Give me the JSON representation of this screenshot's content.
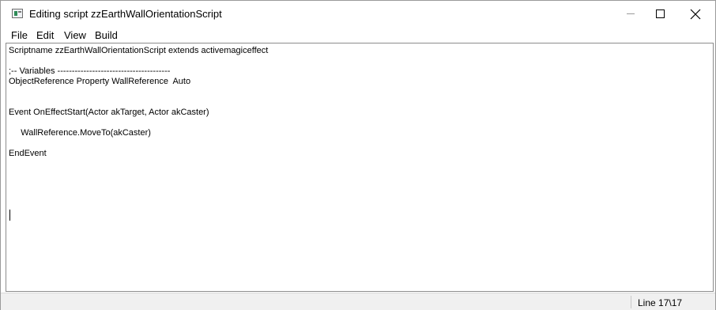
{
  "window": {
    "title": "Editing script zzEarthWallOrientationScript"
  },
  "menu": {
    "file": "File",
    "edit": "Edit",
    "view": "View",
    "build": "Build"
  },
  "editor": {
    "lines": [
      "Scriptname zzEarthWallOrientationScript extends activemagiceffect",
      "",
      ";-- Variables ---------------------------------------",
      "ObjectReference Property WallReference  Auto",
      "",
      "",
      "Event OnEffectStart(Actor akTarget, Actor akCaster)",
      "",
      "     WallReference.MoveTo(akCaster)",
      "",
      "EndEvent"
    ]
  },
  "status": {
    "position": "Line 17\\17"
  },
  "icons": {
    "app": "script-editor-icon",
    "minimize": "minimize-icon",
    "maximize": "maximize-icon",
    "close": "close-icon"
  }
}
